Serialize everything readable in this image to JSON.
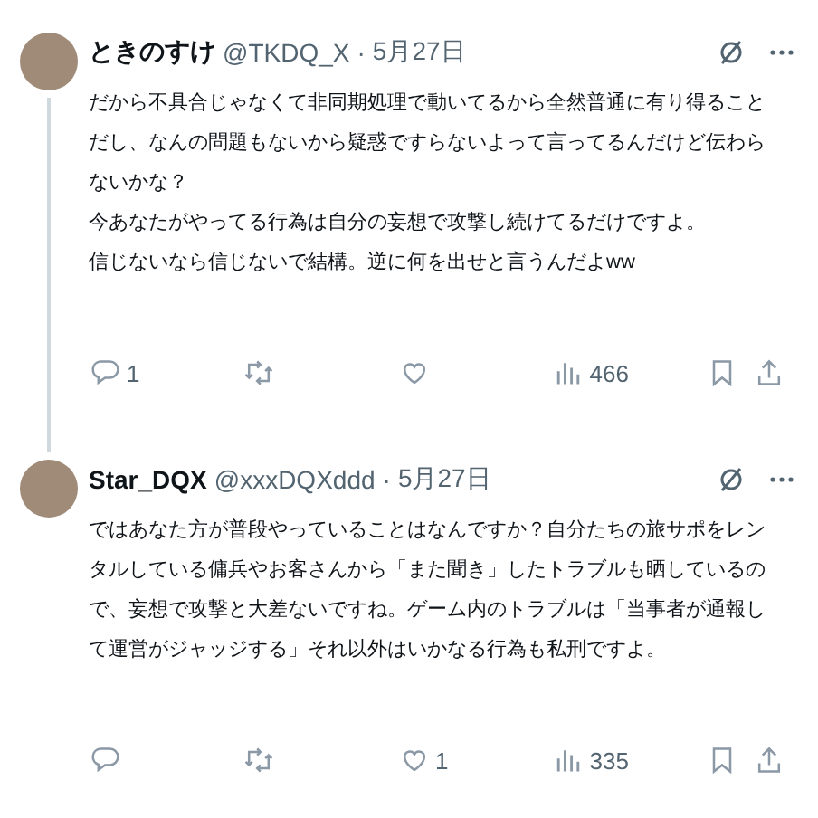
{
  "posts": [
    {
      "name": "ときのすけ",
      "handle": "@TKDQ_X",
      "separator": "·",
      "date": "5月27日",
      "thread_continues": true,
      "paragraphs": [
        "だから不具合じゃなくて非同期処理で動いてるから全然普通に有り得ることだし、なんの問題もないから疑惑ですらないよって言ってるんだけど伝わらないかな？",
        "今あなたがやってる行為は自分の妄想で攻撃し続けてるだけですよ。",
        "信じないなら信じないで結構。逆に何を出せと言うんだよww"
      ],
      "replies": "1",
      "views": "466"
    },
    {
      "name": "Star_DQX",
      "handle": "@xxxDQXddd",
      "separator": "·",
      "date": "5月27日",
      "thread_continues": false,
      "paragraphs": [
        "ではあなた方が普段やっていることはなんですか？自分たちの旅サポをレンタルしている傭兵やお客さんから「また聞き」したトラブルも晒しているので、妄想で攻撃と大差ないですね。ゲーム内のトラブルは「当事者が通報して運営がジャッジする」それ以外はいかなる行為も私刑ですよ。"
      ],
      "likes": "1",
      "views": "335"
    }
  ]
}
